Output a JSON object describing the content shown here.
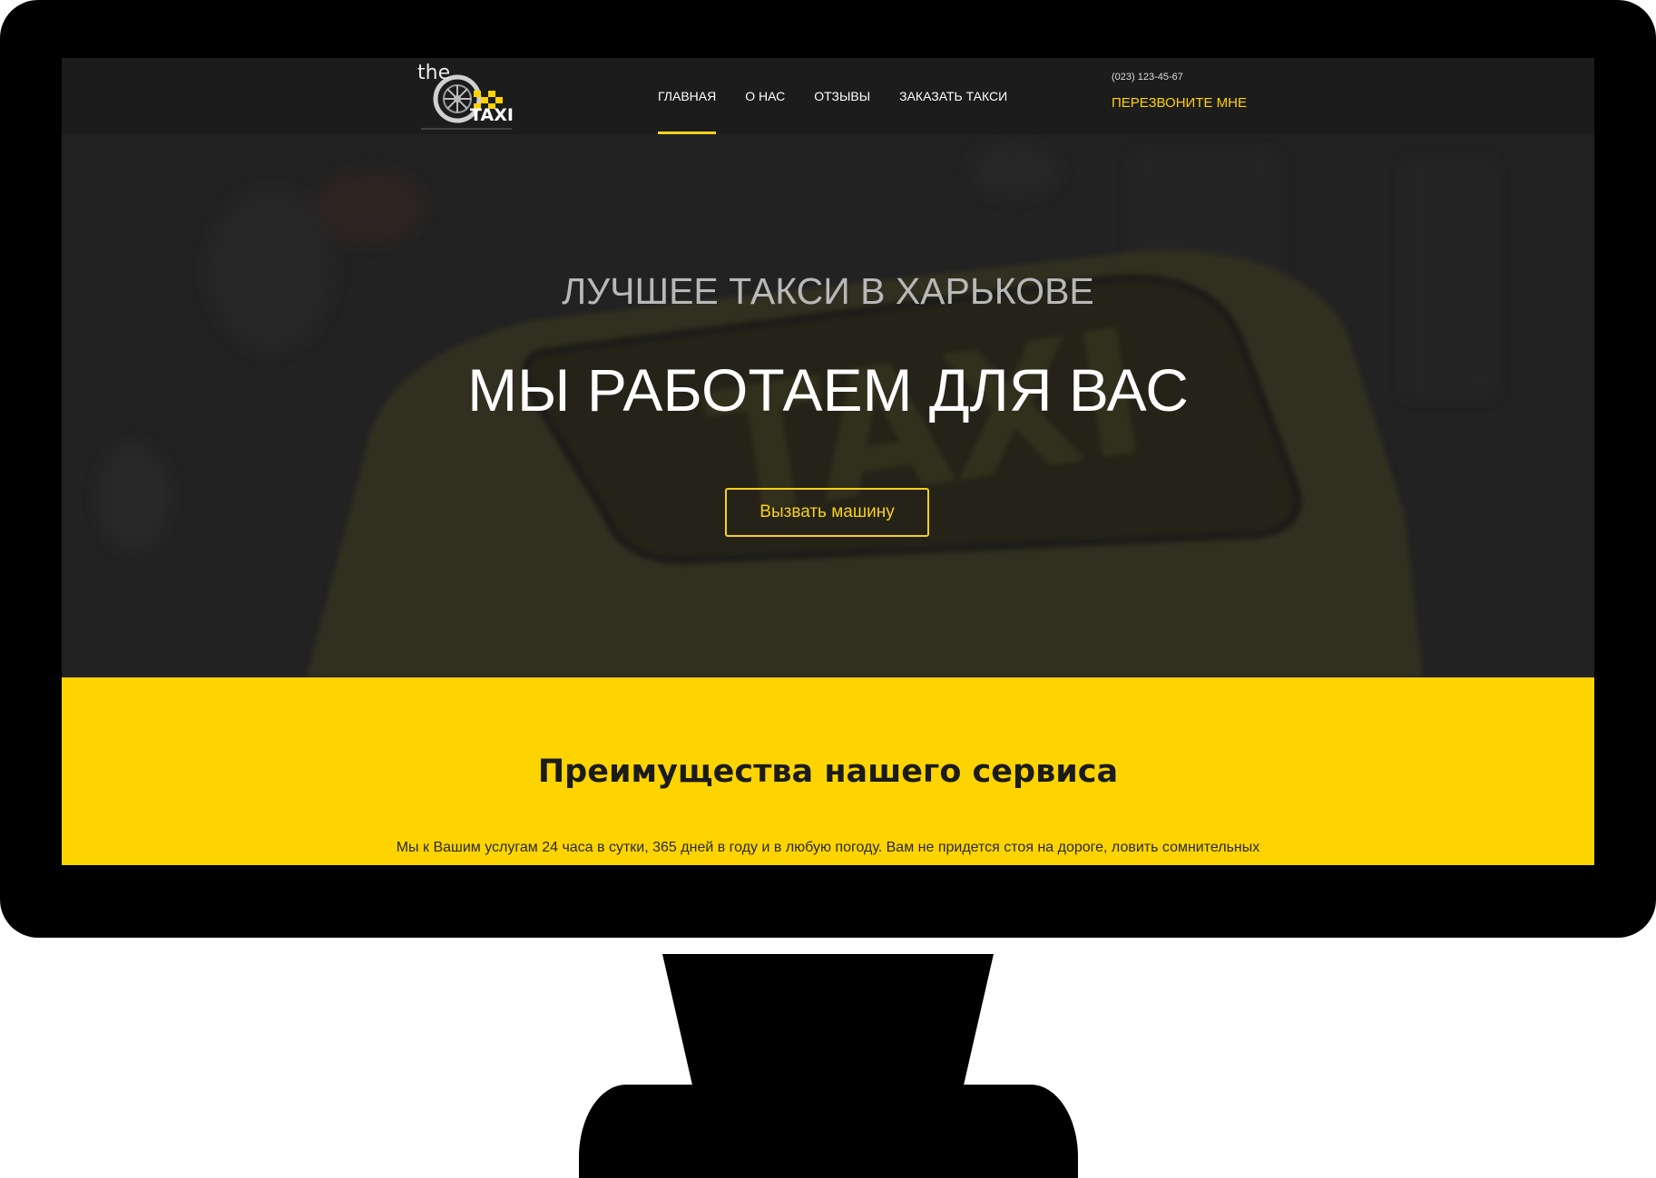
{
  "header": {
    "logo_text_the": "the",
    "logo_text_taxi": "TAXI",
    "nav": [
      {
        "label": "ГЛАВНАЯ",
        "active": true
      },
      {
        "label": "О НАС",
        "active": false
      },
      {
        "label": "ОТЗЫВЫ",
        "active": false
      },
      {
        "label": "ЗАКАЗАТЬ ТАКСИ",
        "active": false
      }
    ],
    "phone": "(023) 123-45-67",
    "callback_label": "ПЕРЕЗВОНИТЕ МНЕ"
  },
  "hero": {
    "subtitle": "ЛУЧШЕЕ ТАКСИ В ХАРЬКОВЕ",
    "title": "МЫ РАБОТАЕМ ДЛЯ ВАС",
    "button_label": "Вызвать машину",
    "background_sign_text": "TAXI"
  },
  "advantages": {
    "title": "Преимущества нашего сервиса",
    "text": "Мы к Вашим услугам 24 часа в сутки, 365 дней в году и в любую погоду. Вам не придется стоя на дороге, ловить сомнительных"
  },
  "colors": {
    "accent": "#f7d117",
    "yellow_section": "#fed400",
    "header_bg": "#1c1c1c"
  }
}
